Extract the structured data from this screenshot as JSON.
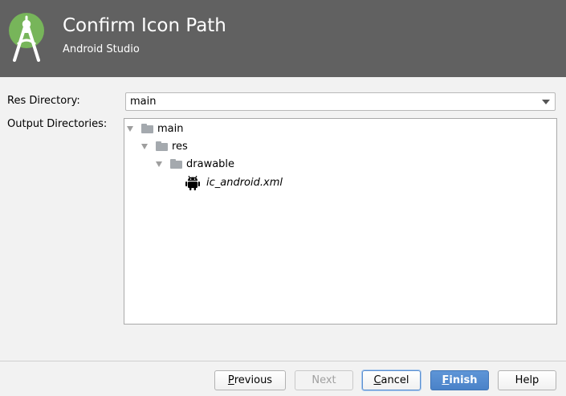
{
  "header": {
    "title": "Confirm Icon Path",
    "subtitle": "Android Studio",
    "background": "#616161",
    "logo_color": "#77b55a"
  },
  "form": {
    "res_label": "Res Directory:",
    "res_value": "main",
    "output_label": "Output Directories:"
  },
  "tree": [
    {
      "label": "main",
      "type": "folder",
      "expanded": true,
      "depth": 0
    },
    {
      "label": "res",
      "type": "folder",
      "expanded": true,
      "depth": 1
    },
    {
      "label": "drawable",
      "type": "folder",
      "expanded": true,
      "depth": 2
    },
    {
      "label": "ic_android.xml",
      "type": "file",
      "icon": "android-icon",
      "depth": 3
    }
  ],
  "buttons": {
    "previous": {
      "mnemonic": "P",
      "rest": "revious"
    },
    "next": {
      "label": "Next",
      "enabled": false
    },
    "cancel": {
      "mnemonic": "C",
      "rest": "ancel"
    },
    "finish": {
      "mnemonic": "F",
      "rest": "inish"
    },
    "help": {
      "label": "Help"
    }
  }
}
